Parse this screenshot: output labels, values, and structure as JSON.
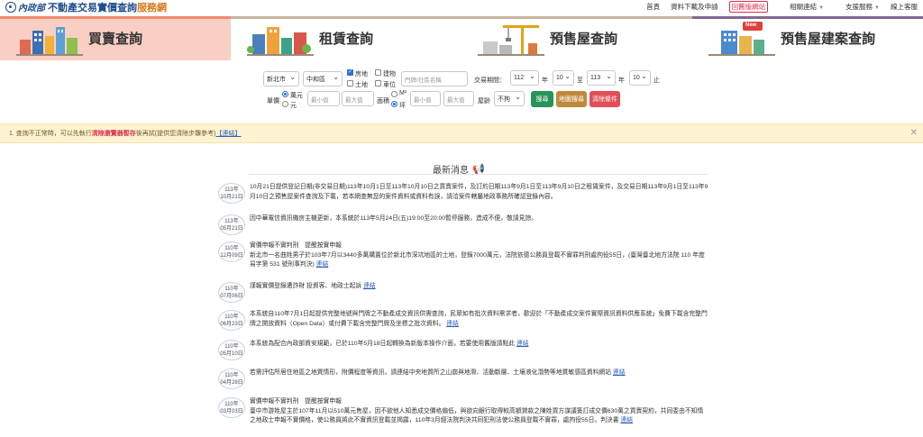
{
  "header": {
    "org_logo": "內政部",
    "site_title_main": "不動產交易實價查詢",
    "site_title_accent": "服務網",
    "nav": {
      "home": "首頁",
      "download": "資料下載及申請",
      "old_site": "回舊版網站",
      "links": "相關連結",
      "support": "支援服務",
      "online_service": "線上客服"
    }
  },
  "tabs": [
    {
      "label": "買賣查詢"
    },
    {
      "label": "租賃查詢"
    },
    {
      "label": "預售屋查詢"
    },
    {
      "label": "預售屋建案查詢",
      "badge": "New"
    }
  ],
  "search": {
    "city": "新北市",
    "district": "中和區",
    "type_house": "房地",
    "type_building": "建物",
    "type_land": "土地",
    "type_parking": "車位",
    "address_placeholder": "門牌/社區名稱",
    "period_label": "交易期間：",
    "year_from": "112",
    "month_from": "10",
    "year_to": "113",
    "month_to": "10",
    "year_unit": "年",
    "to_label": "至",
    "until_label": "止",
    "price_label": "單價",
    "unit_usd": "萬元",
    "unit_yuan": "元",
    "min_placeholder": "最小值",
    "max_placeholder": "最大值",
    "area_label": "面積",
    "area_m2": "M²",
    "area_ping": "坪",
    "age_label": "屋齡",
    "age_value": "不拘",
    "search_btn": "搜尋",
    "map_btn": "地圖搜尋",
    "clear_btn": "清除條件"
  },
  "notice": {
    "prefix": "1. 查詢不正常時，可以先執行",
    "highlight": "清除瀏覽器暫存",
    "suffix": "後再試(提供您清除步驟參考)",
    "link": "【連結】"
  },
  "news": {
    "title": "最新消息",
    "items": [
      {
        "date_top": "113年",
        "date_bottom": "10月21日",
        "text": "10月21日提供登記日期(非交易日期)113年10月1日至113年10月10日之買賣案件，及訂約日期113年9月1日至113年9月10日之租賃案件，及交易日期113年9月1日至113年9月10日之預售屋案件查詢及下載，若本網查無您的案件資料或資料有誤，請洽案件轄屬地政事務所確認登錄內容。"
      },
      {
        "date_top": "113年",
        "date_bottom": "05月21日",
        "text": "因中華電信資訊機房主機更新，本系統於113年5月24日(五)19:00至20:00暫停服務，造成不便，敬請見諒。"
      },
      {
        "date_top": "110年",
        "date_bottom": "12月09日",
        "text": "實價申報不實判刑　提醒按實申報",
        "text2": "新北市一名曲姓男子於103年7月以3440多萬購置位於新北市深坑地區的土地，登錄7000萬元，法院依德公務員登載不實罪判刑處拘役55日，(臺灣臺北地方法院 110 年度易字第 531 號刑事判決)",
        "link": "連結"
      },
      {
        "date_top": "110年",
        "date_bottom": "07月06日",
        "text": "謹報實價登錄遭詐財 投資客、地政士起訴",
        "link": "連結"
      },
      {
        "date_top": "110年",
        "date_bottom": "06月23日",
        "text": "本系統自110年7月1日起提供完整地號與門牌之不動產成交資訊供需查詢，民眾如有批次資料需求者，歡迎於「不動產成交案件實際資訊資料供應系統」免費下載含完整門牌之開放資料（Open Data）或付費下載含完整門牌及坐標之批次資料。",
        "link": "連結"
      },
      {
        "date_top": "110年",
        "date_bottom": "05月10日",
        "text": "本系統為配合內政部資安規範，已於110年5月18日起轉換為新版本操作介面，若要使用舊版請點此",
        "link": "連結"
      },
      {
        "date_top": "110年",
        "date_bottom": "04月28日",
        "text": "若需評估所居住地區之地質情形，附價程度等資訊，請連結中央地質所之山崩與地滑、活動斷層、土壤液化潛勢等地質敏感區資料網站",
        "link": "連結"
      },
      {
        "date_top": "110年",
        "date_bottom": "03月03日",
        "text": "實價申報不實判刑　提醒按實申報",
        "text2": "臺中市游姓屋主於107年11月以510萬元售屋，因不欲他人知悉成交價格偏低，與欲向銀行取得較高額貸款之陳姓買方謀議簽訂成交價630萬之買賣契約，共同委由不知情之地政士申報不實價格，使公務員將此不實資訊登載並揭露，110年3月經法院判決共同犯刑法使公務員登載不實罪，處拘役55日。判決書",
        "link": "連結"
      }
    ]
  }
}
